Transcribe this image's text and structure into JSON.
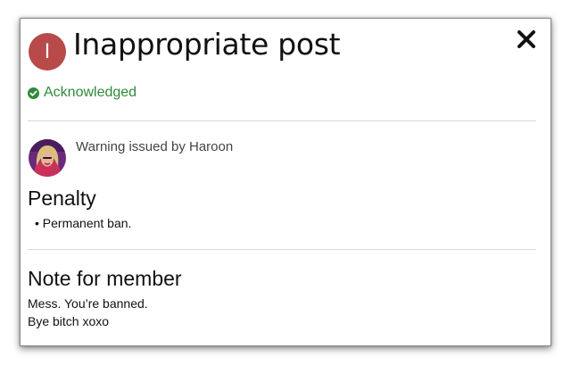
{
  "dialog": {
    "avatar_initial": "I",
    "title": "Inappropriate post",
    "close_icon": "close-icon",
    "status": {
      "label": "Acknowledged",
      "icon": "check-circle-icon",
      "color": "#2f8a3a"
    },
    "warning": {
      "issued_by_text": "Warning issued by Haroon",
      "avatar_icon": "user-avatar"
    },
    "penalty": {
      "heading": "Penalty",
      "items": [
        "Permanent ban."
      ]
    },
    "note": {
      "heading": "Note for member",
      "lines": [
        "Mess. You’re banned.",
        "Bye bitch xoxo"
      ]
    }
  }
}
